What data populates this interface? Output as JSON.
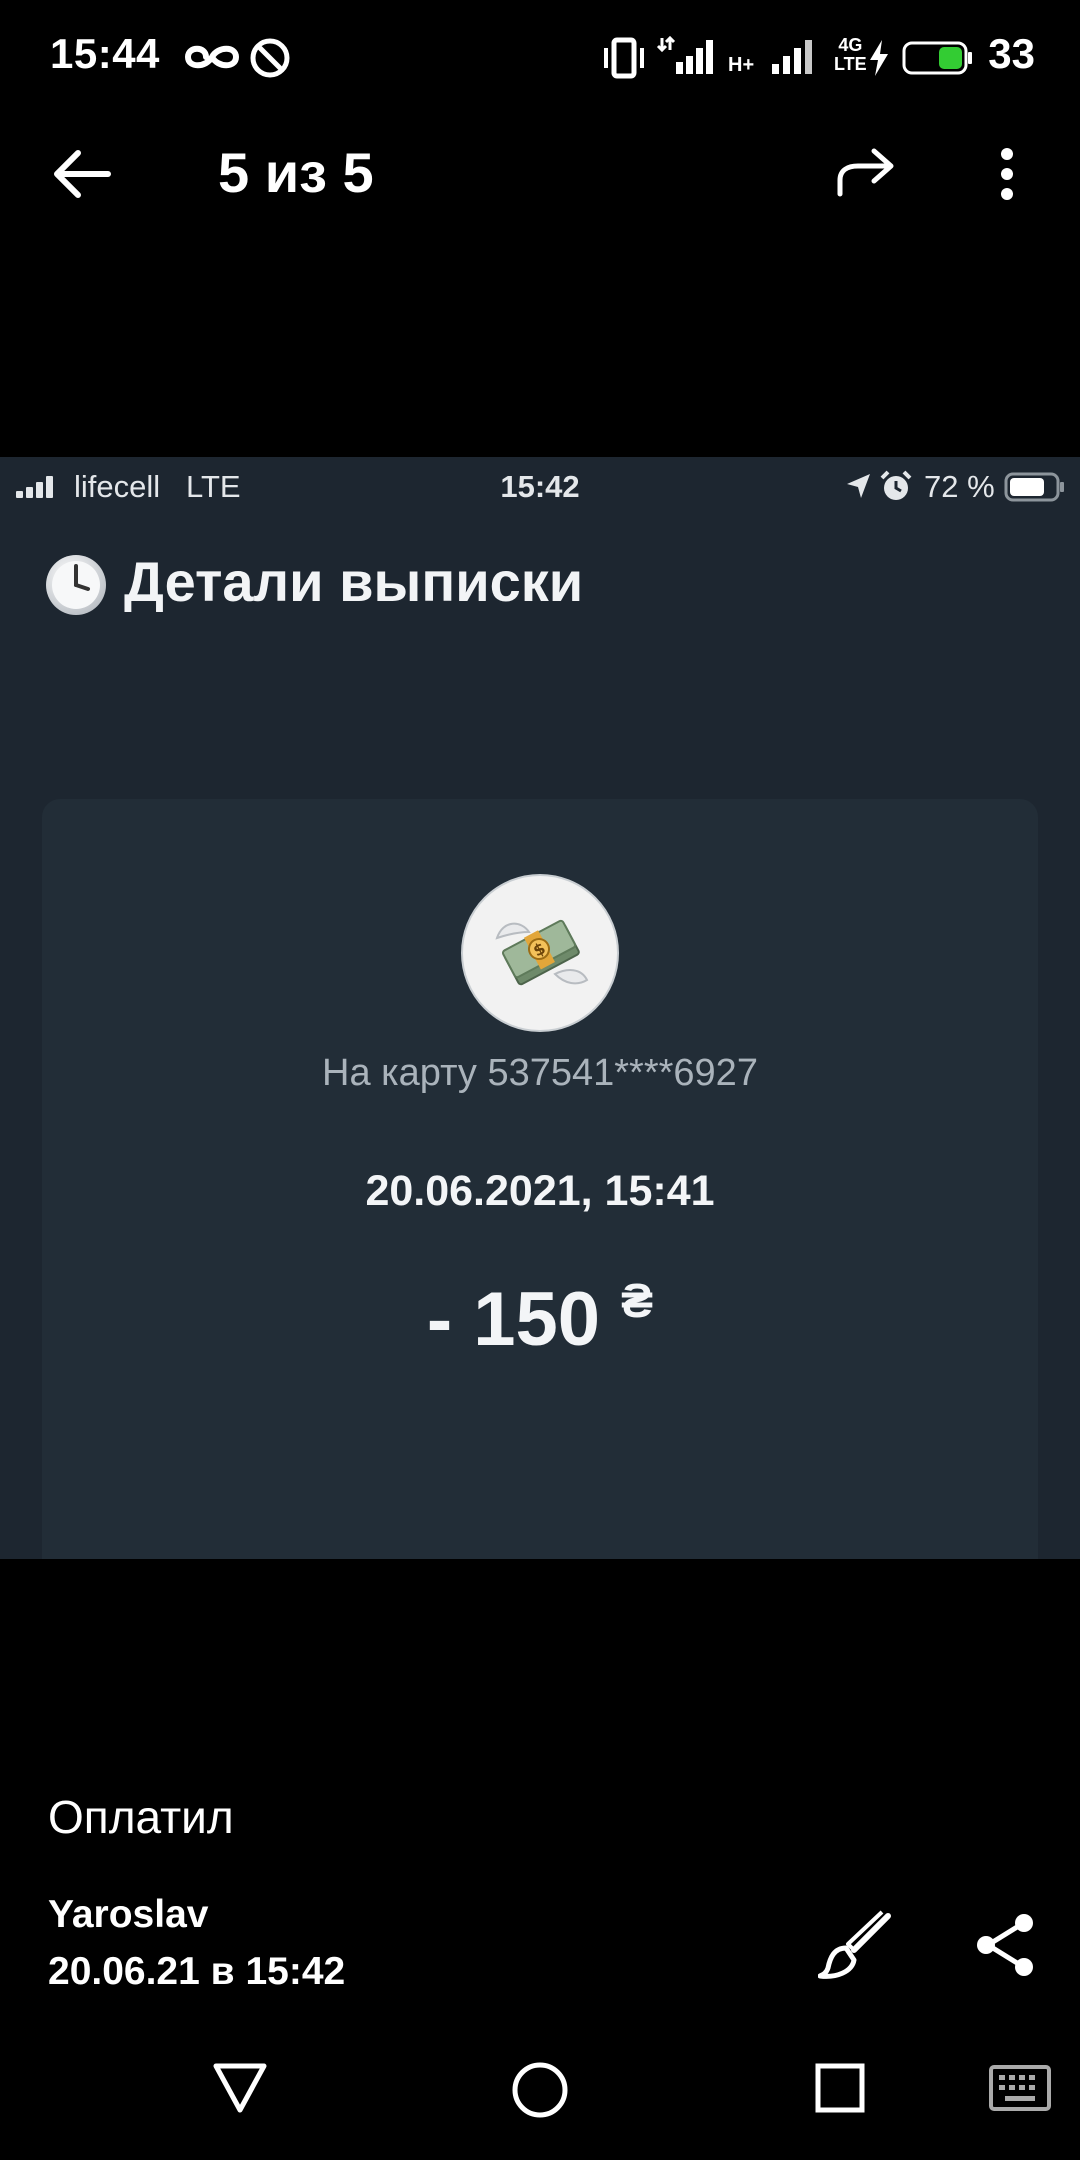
{
  "android_status": {
    "time": "15:44",
    "network_h": "H+",
    "network_4g": "4G",
    "network_lte": "LTE",
    "battery_text": "33"
  },
  "viewer": {
    "counter": "5 из 5"
  },
  "embedded": {
    "status": {
      "carrier": "lifecell",
      "network": "LTE",
      "time": "15:42",
      "battery": "72 %"
    },
    "title_icon": "clock-emoji",
    "title": "Детали выписки",
    "card": {
      "icon": "money-with-wings-emoji",
      "to_card": "На карту 537541****6927",
      "date": "20.06.2021, 15:41",
      "amount": "- 150",
      "currency": "₴"
    }
  },
  "caption": {
    "text": "Оплатил",
    "author": "Yaroslav",
    "timestamp": "20.06.21 в 15:42"
  },
  "colors": {
    "screenshot_bg": "#1d2630",
    "card_bg": "#222d37",
    "battery_green": "#33cc33"
  }
}
